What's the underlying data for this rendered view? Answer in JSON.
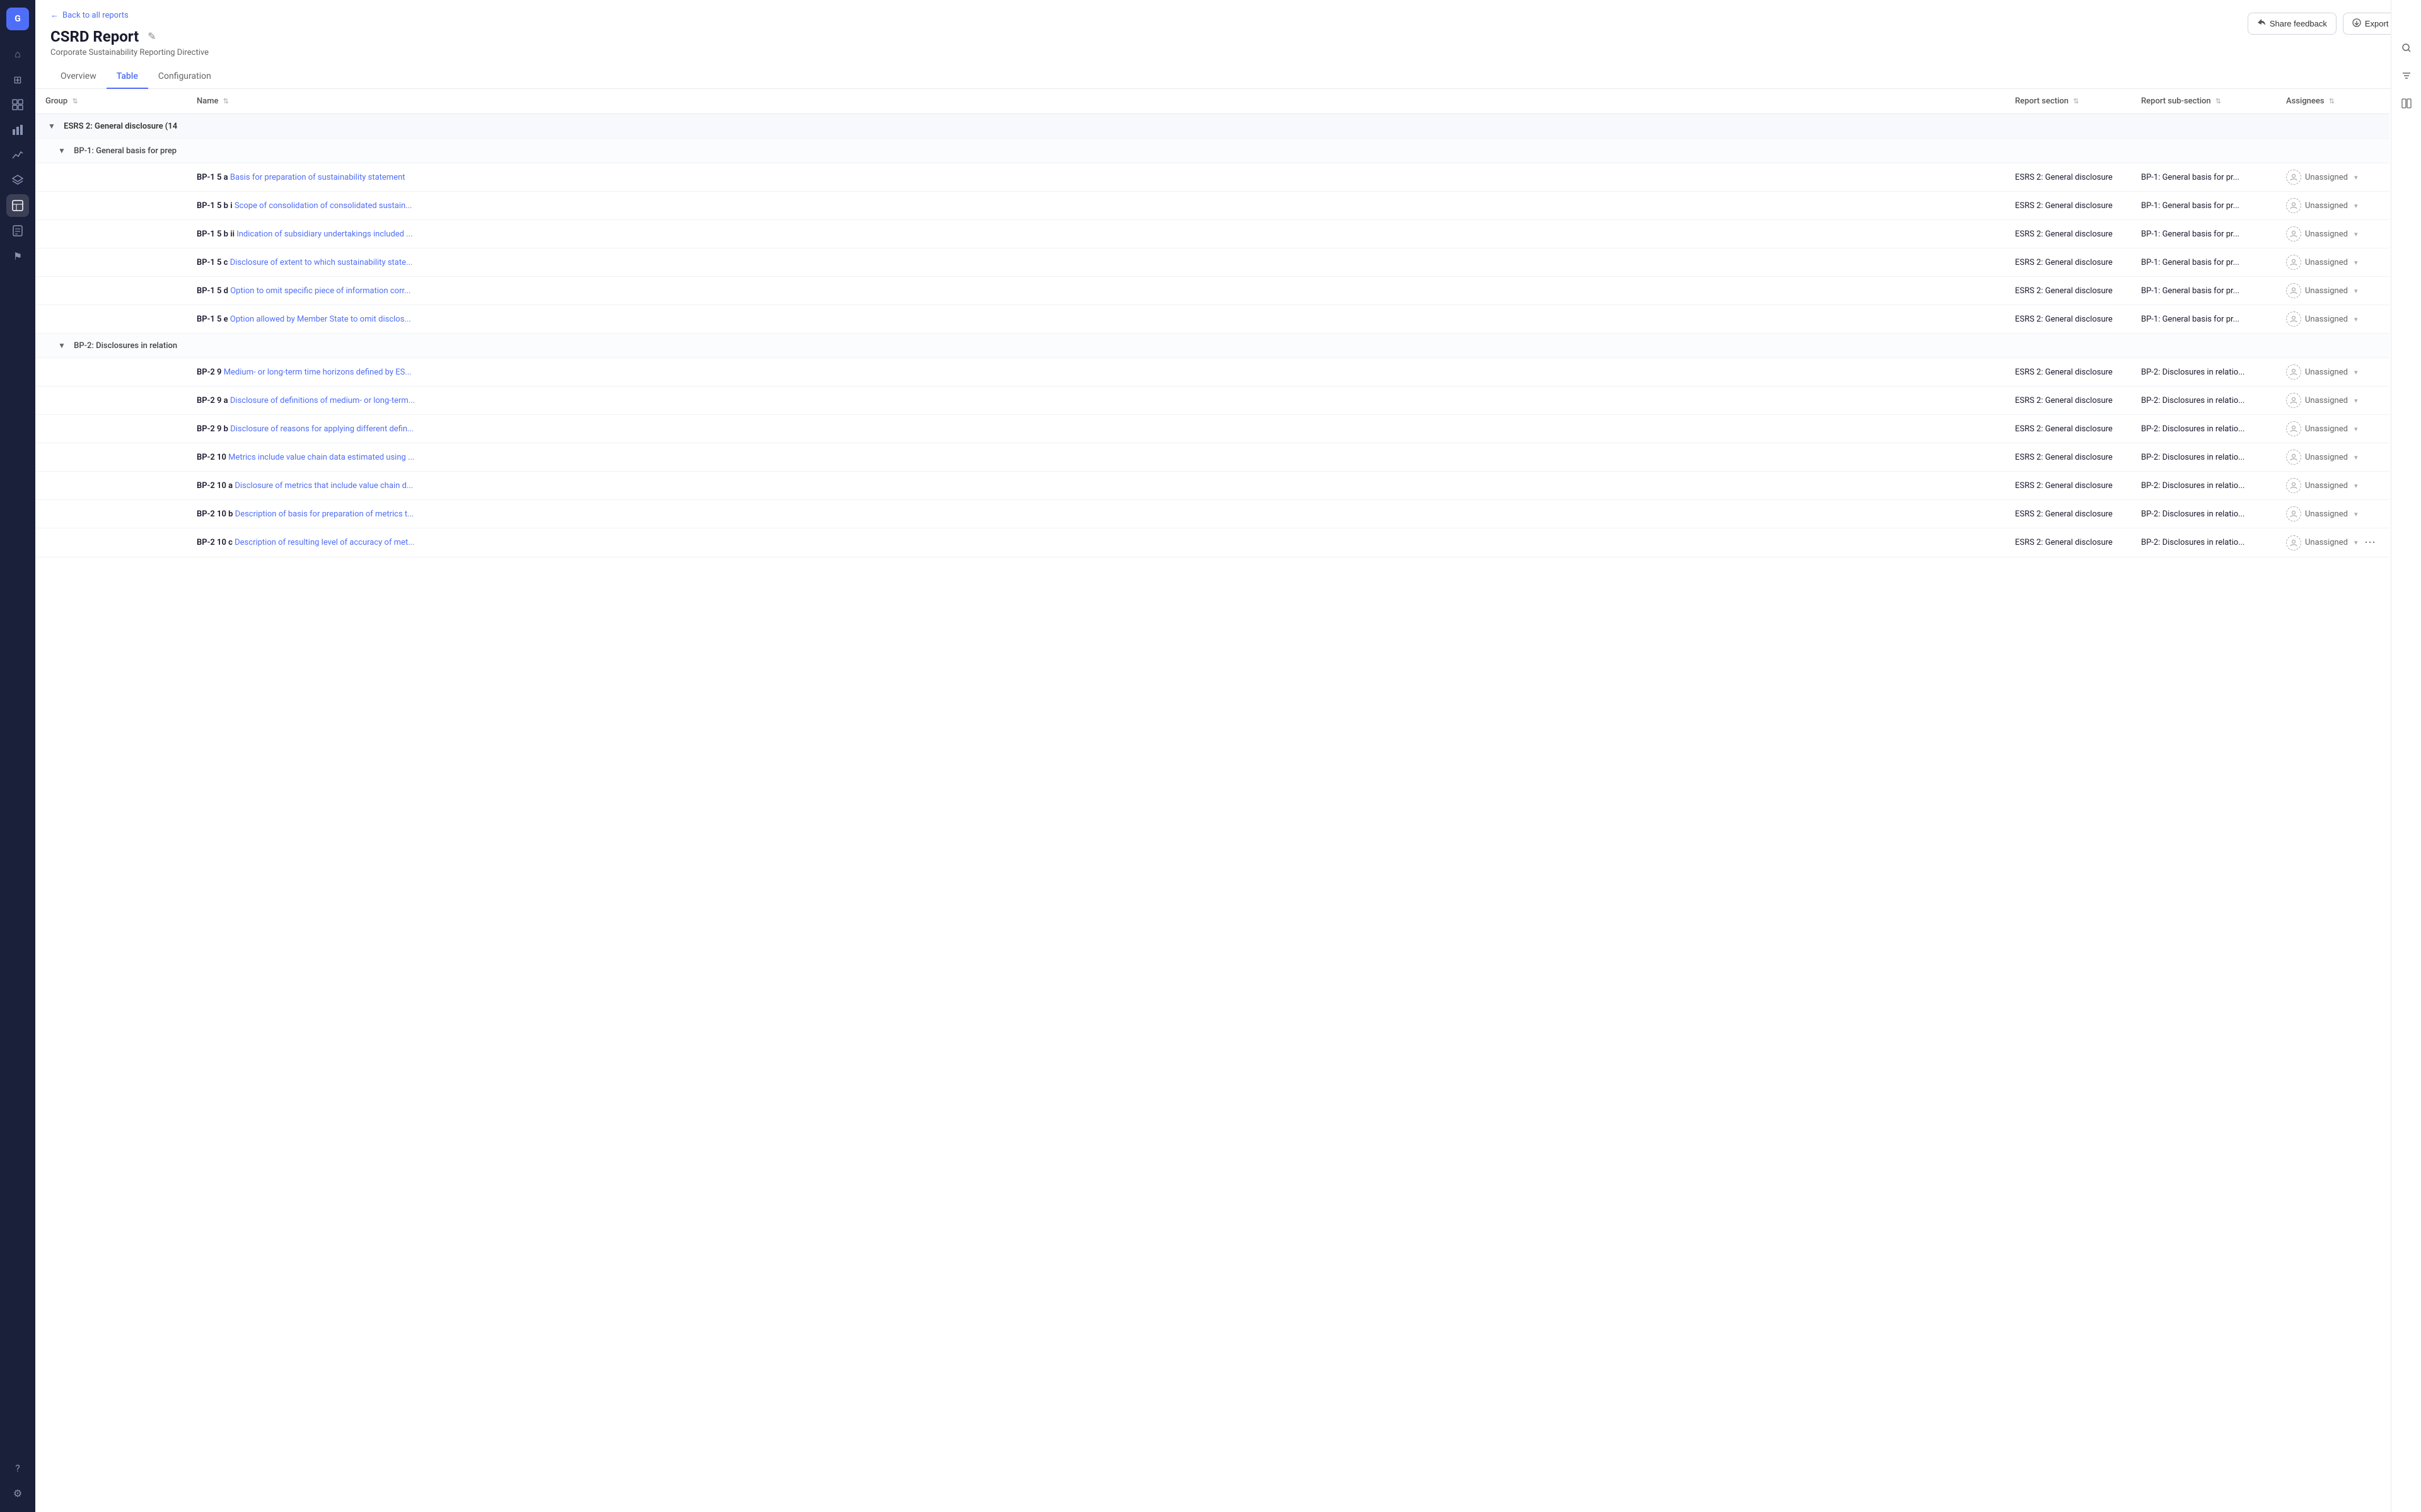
{
  "app": {
    "logo": "G"
  },
  "sidebar": {
    "items": [
      {
        "id": "home",
        "icon": "⌂",
        "active": false
      },
      {
        "id": "grid",
        "icon": "⊞",
        "active": false
      },
      {
        "id": "table",
        "icon": "≡",
        "active": false
      },
      {
        "id": "bar-chart",
        "icon": "▦",
        "active": false
      },
      {
        "id": "line-chart",
        "icon": "↗",
        "active": false
      },
      {
        "id": "layers",
        "icon": "⧉",
        "active": false
      },
      {
        "id": "analytics",
        "icon": "◫",
        "active": true
      },
      {
        "id": "reports",
        "icon": "⬚",
        "active": false
      },
      {
        "id": "flag",
        "icon": "⚑",
        "active": false
      }
    ],
    "bottom_items": [
      {
        "id": "help",
        "icon": "?"
      },
      {
        "id": "settings",
        "icon": "⚙"
      }
    ]
  },
  "header": {
    "back_label": "Back to all reports",
    "title": "CSRD Report",
    "subtitle": "Corporate Sustainability Reporting Directive",
    "share_label": "Share feedback",
    "export_label": "Export"
  },
  "tabs": [
    {
      "id": "overview",
      "label": "Overview",
      "active": false
    },
    {
      "id": "table",
      "label": "Table",
      "active": true
    },
    {
      "id": "configuration",
      "label": "Configuration",
      "active": false
    }
  ],
  "table": {
    "columns": [
      {
        "id": "group",
        "label": "Group"
      },
      {
        "id": "name",
        "label": "Name"
      },
      {
        "id": "report_section",
        "label": "Report section"
      },
      {
        "id": "report_subsection",
        "label": "Report sub-section"
      },
      {
        "id": "assignees",
        "label": "Assignees"
      }
    ],
    "groups": [
      {
        "id": "esrs2",
        "label": "ESRS 2: General disclosure (14",
        "expanded": true,
        "subgroups": [
          {
            "id": "bp1",
            "label": "BP-1: General basis for prep",
            "expanded": true,
            "rows": [
              {
                "code": "BP-1 5 a",
                "name": "Basis for preparation of sustainability statement",
                "name_truncated": false,
                "report_section": "ESRS 2: General disclosure",
                "report_subsection": "BP-1: General basis for pr...",
                "assignee": "Unassigned"
              },
              {
                "code": "BP-1 5 b i",
                "name": "Scope of consolidation of consolidated sustain...",
                "name_truncated": true,
                "report_section": "ESRS 2: General disclosure",
                "report_subsection": "BP-1: General basis for pr...",
                "assignee": "Unassigned"
              },
              {
                "code": "BP-1 5 b ii",
                "name": "Indication of subsidiary undertakings included ...",
                "name_truncated": true,
                "report_section": "ESRS 2: General disclosure",
                "report_subsection": "BP-1: General basis for pr...",
                "assignee": "Unassigned"
              },
              {
                "code": "BP-1 5 c",
                "name": "Disclosure of extent to which sustainability state...",
                "name_truncated": true,
                "report_section": "ESRS 2: General disclosure",
                "report_subsection": "BP-1: General basis for pr...",
                "assignee": "Unassigned"
              },
              {
                "code": "BP-1 5 d",
                "name": "Option to omit specific piece of information corr...",
                "name_truncated": true,
                "report_section": "ESRS 2: General disclosure",
                "report_subsection": "BP-1: General basis for pr...",
                "assignee": "Unassigned"
              },
              {
                "code": "BP-1 5 e",
                "name": "Option allowed by Member State to omit disclos...",
                "name_truncated": true,
                "report_section": "ESRS 2: General disclosure",
                "report_subsection": "BP-1: General basis for pr...",
                "assignee": "Unassigned"
              }
            ]
          },
          {
            "id": "bp2",
            "label": "BP-2: Disclosures in relation",
            "expanded": true,
            "rows": [
              {
                "code": "BP-2 9",
                "name": "Medium- or long-term time horizons defined by ES...",
                "name_truncated": true,
                "report_section": "ESRS 2: General disclosure",
                "report_subsection": "BP-2: Disclosures in relatio...",
                "assignee": "Unassigned"
              },
              {
                "code": "BP-2 9 a",
                "name": "Disclosure of definitions of medium- or long-term...",
                "name_truncated": true,
                "report_section": "ESRS 2: General disclosure",
                "report_subsection": "BP-2: Disclosures in relatio...",
                "assignee": "Unassigned"
              },
              {
                "code": "BP-2 9 b",
                "name": "Disclosure of reasons for applying different defin...",
                "name_truncated": true,
                "report_section": "ESRS 2: General disclosure",
                "report_subsection": "BP-2: Disclosures in relatio...",
                "assignee": "Unassigned"
              },
              {
                "code": "BP-2 10",
                "name": "Metrics include value chain data estimated using ...",
                "name_truncated": true,
                "report_section": "ESRS 2: General disclosure",
                "report_subsection": "BP-2: Disclosures in relatio...",
                "assignee": "Unassigned"
              },
              {
                "code": "BP-2 10 a",
                "name": "Disclosure of metrics that include value chain d...",
                "name_truncated": true,
                "report_section": "ESRS 2: General disclosure",
                "report_subsection": "BP-2: Disclosures in relatio...",
                "assignee": "Unassigned"
              },
              {
                "code": "BP-2 10 b",
                "name": "Description of basis for preparation of metrics t...",
                "name_truncated": true,
                "report_section": "ESRS 2: General disclosure",
                "report_subsection": "BP-2: Disclosures in relatio...",
                "assignee": "Unassigned"
              },
              {
                "code": "BP-2 10 c",
                "name": "Description of resulting level of accuracy of met...",
                "name_truncated": true,
                "report_section": "ESRS 2: General disclosure",
                "report_subsection": "BP-2: Disclosures in relatio...",
                "assignee": "Unassigned",
                "has_more": true
              }
            ]
          }
        ]
      }
    ]
  }
}
